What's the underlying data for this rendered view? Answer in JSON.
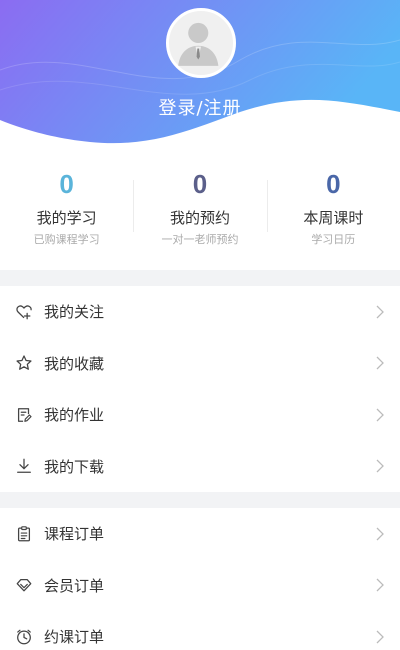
{
  "header": {
    "login_label": "登录/注册",
    "gradient_start": "#8b6cf2",
    "gradient_end": "#59b5f7"
  },
  "stats": [
    {
      "value": "0",
      "label": "我的学习",
      "sub": "已购课程学习",
      "color": "#5ab4da"
    },
    {
      "value": "0",
      "label": "我的预约",
      "sub": "一对一老师预约",
      "color": "#5b5f8a"
    },
    {
      "value": "0",
      "label": "本周课时",
      "sub": "学习日历",
      "color": "#4a67a8"
    }
  ],
  "menu_group_1": [
    {
      "label": "我的关注",
      "icon": "heart-plus-icon"
    },
    {
      "label": "我的收藏",
      "icon": "star-icon"
    },
    {
      "label": "我的作业",
      "icon": "homework-icon"
    },
    {
      "label": "我的下载",
      "icon": "download-icon"
    }
  ],
  "menu_group_2": [
    {
      "label": "课程订单",
      "icon": "clipboard-icon"
    },
    {
      "label": "会员订单",
      "icon": "diamond-icon"
    },
    {
      "label": "约课订单",
      "icon": "clock-icon"
    }
  ]
}
